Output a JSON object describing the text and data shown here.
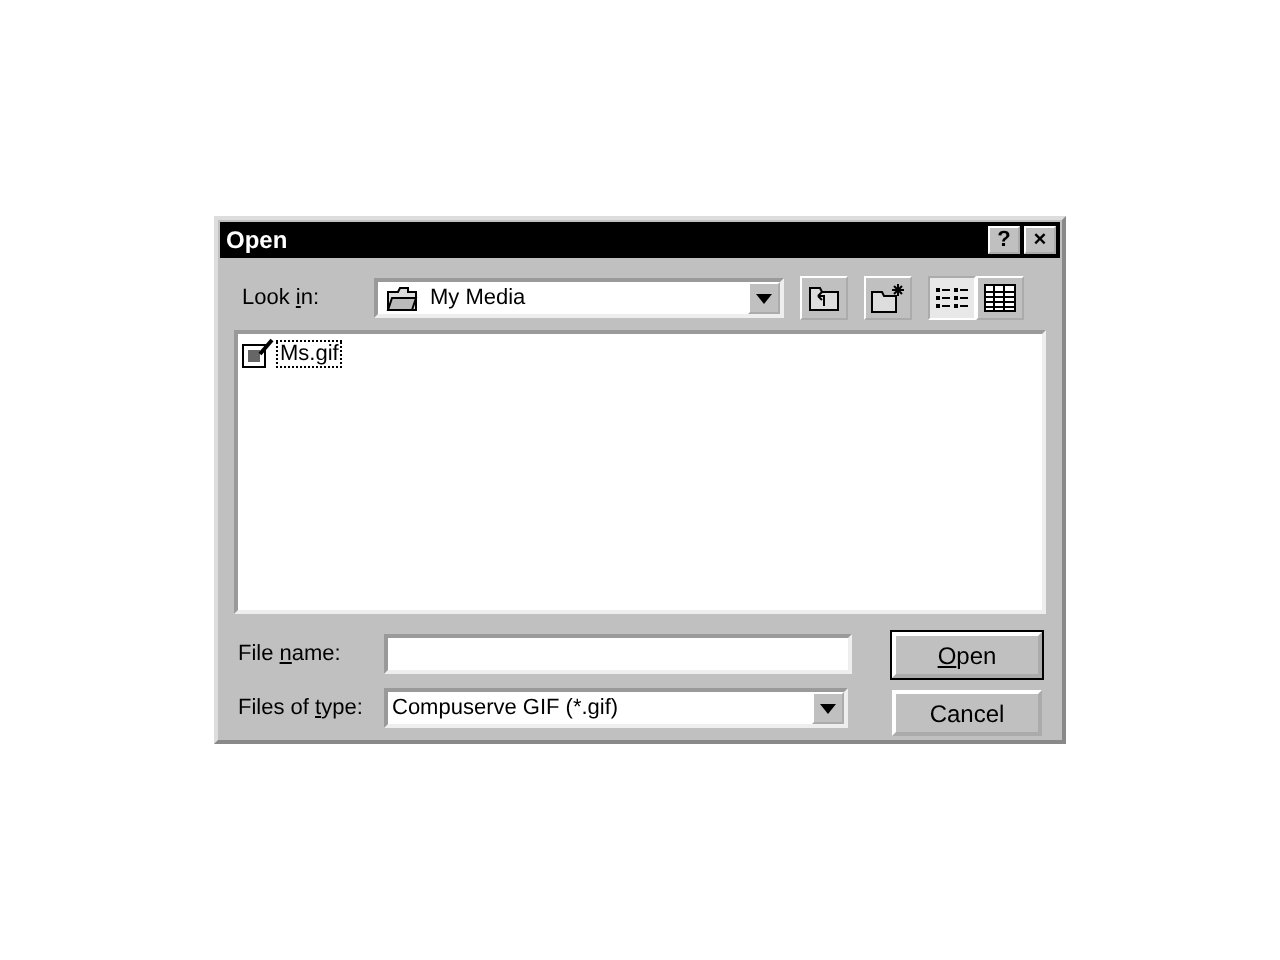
{
  "window": {
    "title": "Open",
    "title_buttons": [
      "?",
      "×"
    ]
  },
  "look_in": {
    "label": {
      "before": "Look ",
      "key": "i",
      "after": "n:"
    },
    "value": "My Media"
  },
  "view_buttons": [
    {
      "kind": "list",
      "selected": true
    },
    {
      "kind": "details",
      "selected": false
    }
  ],
  "files": [
    {
      "name": "Ms.gif",
      "selected": true
    }
  ],
  "file_name": {
    "label": {
      "before": "File ",
      "key": "n",
      "after": "ame:"
    }
  },
  "files_of_type": {
    "label": {
      "before": "Files of ",
      "key": "t",
      "after": "ype:"
    },
    "value": "Compuserve GIF (*.gif)"
  },
  "buttons": [
    {
      "label": {
        "key": "O",
        "after": "pen"
      }
    },
    {
      "label": {
        "before": "Cancel"
      }
    }
  ]
}
